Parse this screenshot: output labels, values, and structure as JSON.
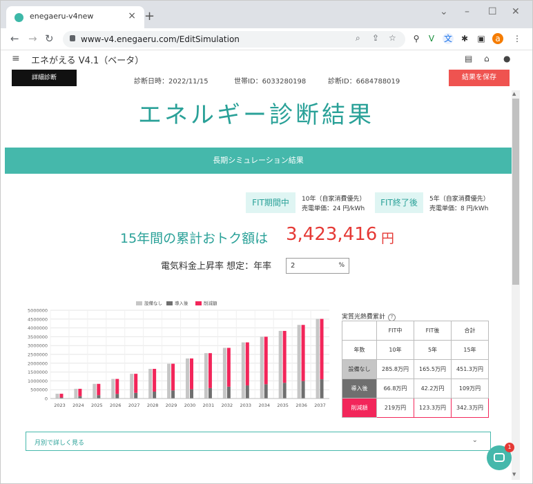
{
  "browser": {
    "tab_title": "enegaeru-v4new",
    "tab_close": "×",
    "new_tab": "+",
    "url": "www-v4.enegaeru.com/EditSimulation",
    "profile_initial": "a"
  },
  "app": {
    "title": "エネがえる V4.1（ベータ）",
    "detail_button": "詳細診断",
    "diagnosis_date": "診断日時：2022/11/15",
    "household_id": "世帯ID：6033280198",
    "diagnosis_id": "診断ID：6684788019",
    "save_button": "結果を保存"
  },
  "main": {
    "title": "エネルギー診断結果",
    "banner": "長期シミュレーション結果",
    "fit_period_label": "FIT期間中",
    "fit_period_line1": "10年（自家消費優先）",
    "fit_period_line2": "売電単価：24 円/kWh",
    "fit_end_label": "FIT終了後",
    "fit_end_line1": "5年（自家消費優先）",
    "fit_end_line2": "売電単価：8 円/kWh",
    "total_label": "15年間の累計おトク額は",
    "total_value": "3,423,416",
    "total_unit": "円",
    "rate_label": "電気料金上昇率 想定：年率",
    "rate_value": "2",
    "rate_unit": "%",
    "monthly_toggle": "月別で詳しく見る"
  },
  "cost_table": {
    "title": "実質光熱費累計",
    "help": "?",
    "headers": [
      "",
      "FIT中",
      "FIT後",
      "合計"
    ],
    "rows": [
      [
        "年数",
        "10年",
        "5年",
        "15年"
      ],
      [
        "設備なし",
        "285.8万円",
        "165.5万円",
        "451.3万円"
      ],
      [
        "導入後",
        "66.8万円",
        "42.2万円",
        "109万円"
      ],
      [
        "削減額",
        "219万円",
        "123.3万円",
        "342.3万円"
      ]
    ]
  },
  "chart_data": {
    "type": "bar",
    "categories": [
      "2023",
      "2024",
      "2025",
      "2026",
      "2027",
      "2028",
      "2029",
      "2030",
      "2031",
      "2032",
      "2033",
      "2034",
      "2035",
      "2036",
      "2037"
    ],
    "series": [
      {
        "name": "設備なし",
        "color": "#c6c6c6",
        "values": [
          270000,
          550000,
          830000,
          1110000,
          1400000,
          1680000,
          1970000,
          2270000,
          2570000,
          2870000,
          3180000,
          3500000,
          3830000,
          4170000,
          4510000
        ]
      },
      {
        "name": "導入後",
        "color": "#6f6f6f",
        "values": [
          60000,
          130000,
          190000,
          260000,
          320000,
          390000,
          460000,
          520000,
          590000,
          670000,
          740000,
          810000,
          890000,
          990000,
          1090000
        ]
      },
      {
        "name": "削減額",
        "color": "#f2265a",
        "values": [
          210000,
          420000,
          640000,
          850000,
          1080000,
          1290000,
          1510000,
          1750000,
          1980000,
          2200000,
          2440000,
          2690000,
          2940000,
          3180000,
          3420000
        ]
      }
    ],
    "yticks": [
      "5000000",
      "4500000",
      "4000000",
      "3500000",
      "3000000",
      "2500000",
      "2000000",
      "1500000",
      "1000000",
      "500000",
      "0"
    ],
    "ylim": [
      0,
      5000000
    ],
    "grid": true,
    "legend": "top"
  }
}
